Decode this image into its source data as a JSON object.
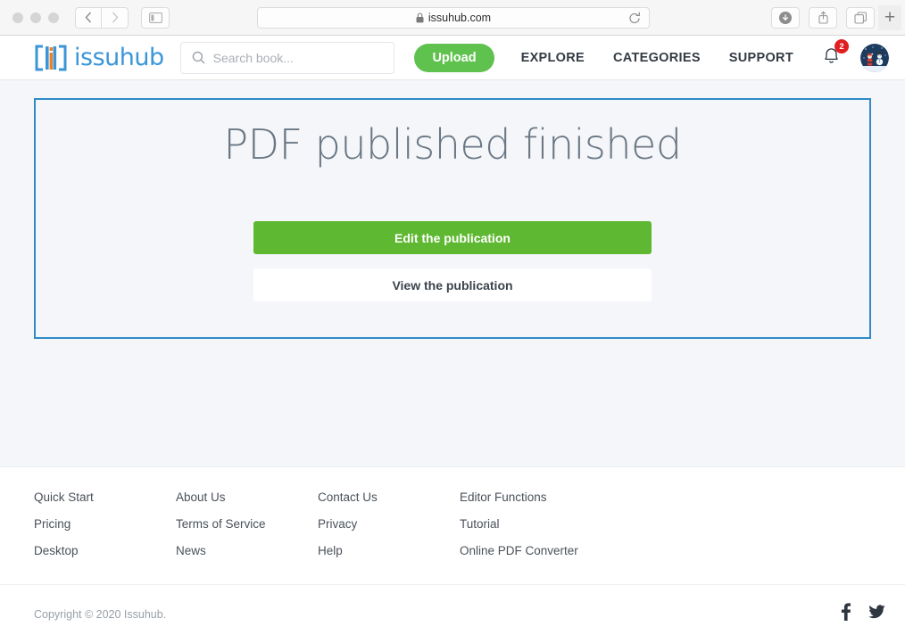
{
  "browser": {
    "url": "issuhub.com",
    "lock_icon": "lock-icon",
    "reload_icon": "reload-icon",
    "back_icon": "back-chevron-icon",
    "forward_icon": "forward-chevron-icon",
    "sidebar_icon": "sidebar-toggle-icon",
    "download_icon": "download-icon",
    "share_icon": "share-icon",
    "tabs_icon": "tab-overview-icon",
    "new_tab_label": "+"
  },
  "header": {
    "logo_text": "issuhub",
    "logo_mark": "bracket-i-logo-icon",
    "search": {
      "placeholder": "Search book...",
      "value": "",
      "icon": "search-icon"
    },
    "upload_label": "Upload",
    "nav": [
      {
        "label": "EXPLORE"
      },
      {
        "label": "CATEGORIES"
      },
      {
        "label": "SUPPORT"
      }
    ],
    "notifications": {
      "icon": "bell-icon",
      "count": "2"
    },
    "avatar_alt": "user-avatar-santa-snowman"
  },
  "main": {
    "title": "PDF published finished",
    "primary_button": "Edit the publication",
    "secondary_button": "View the publication"
  },
  "footer": {
    "columns": [
      {
        "links": [
          {
            "label": "Quick Start"
          },
          {
            "label": "Pricing"
          },
          {
            "label": "Desktop"
          }
        ]
      },
      {
        "links": [
          {
            "label": "About Us"
          },
          {
            "label": "Terms of Service"
          },
          {
            "label": "News"
          }
        ]
      },
      {
        "links": [
          {
            "label": "Contact Us"
          },
          {
            "label": "Privacy"
          },
          {
            "label": "Help"
          }
        ]
      },
      {
        "links": [
          {
            "label": "Editor Functions"
          },
          {
            "label": "Tutorial"
          },
          {
            "label": "Online PDF Converter"
          }
        ]
      }
    ],
    "copyright": "Copyright © 2020 Issuhub.",
    "socials": [
      {
        "name": "facebook-icon"
      },
      {
        "name": "twitter-icon"
      }
    ]
  },
  "colors": {
    "brand_blue": "#3b96d9",
    "accent_orange": "#f08021",
    "upload_green": "#5fc14e",
    "primary_green": "#5fb831",
    "card_border": "#2e8bc8",
    "badge_red": "#e02020",
    "page_bg": "#f4f6f9"
  }
}
